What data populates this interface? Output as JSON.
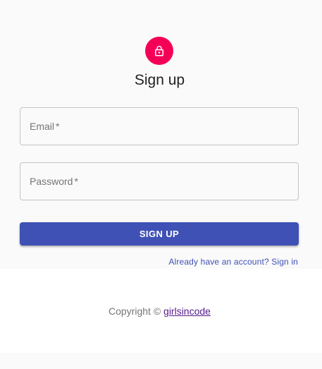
{
  "avatar": {
    "icon": "lock-outlined-icon",
    "color": "#f50057"
  },
  "form": {
    "title": "Sign up",
    "email": {
      "label": "Email",
      "required_mark": "*"
    },
    "password": {
      "label": "Password",
      "required_mark": "*"
    },
    "submit_label": "SIGN UP",
    "signin_link": "Already have an account? Sign in"
  },
  "footer": {
    "copyright_prefix": "Copyright ©",
    "site_link": "girlsincode"
  },
  "colors": {
    "primary": "#3f51b5",
    "secondary": "#f50057",
    "link_visited": "#551a8b",
    "background": "#fafafa"
  }
}
